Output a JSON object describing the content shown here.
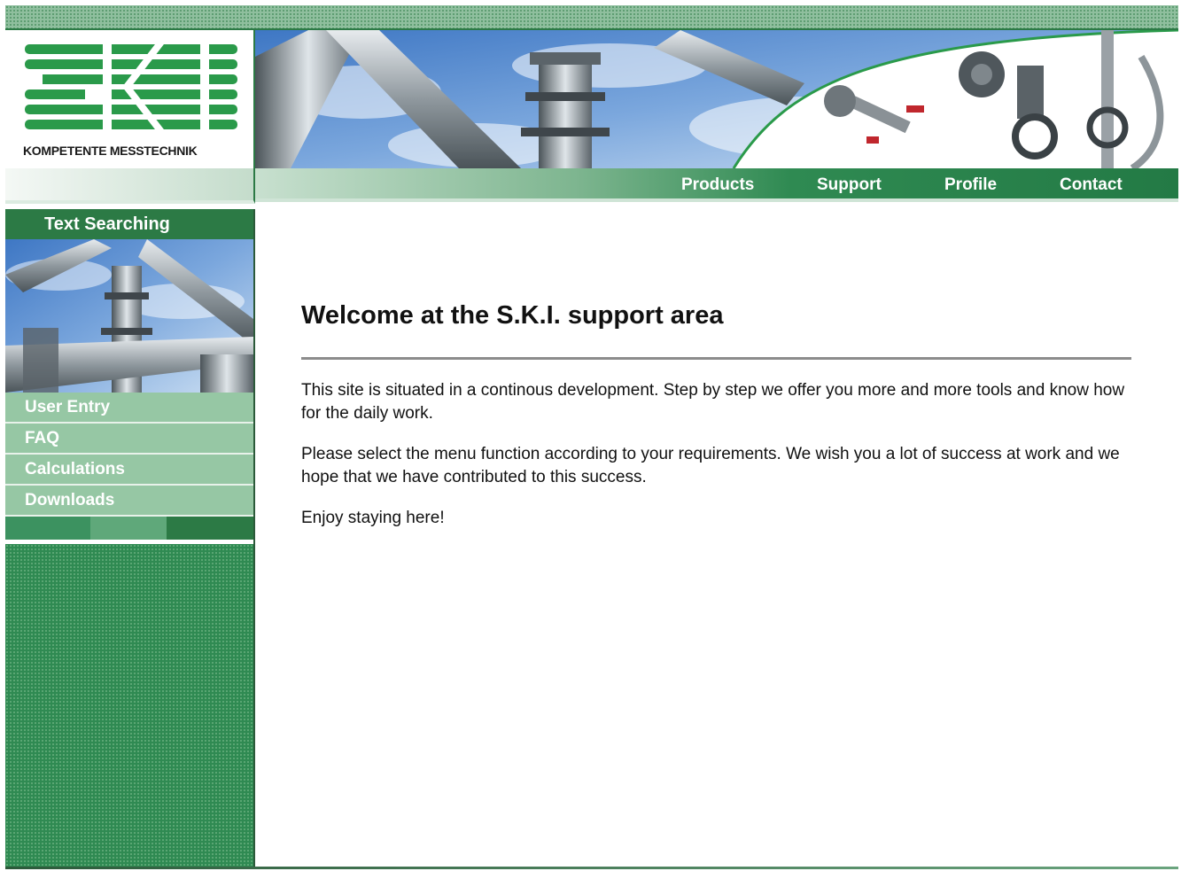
{
  "logo": {
    "tagline": "KOMPETENTE MESSTECHNIK",
    "brand_color": "#2a9a4a"
  },
  "nav": {
    "items": [
      "Products",
      "Support",
      "Profile",
      "Contact"
    ]
  },
  "sidebar": {
    "title": "Text Searching",
    "menu": [
      "User Entry",
      "FAQ",
      "Calculations",
      "Downloads"
    ]
  },
  "main": {
    "heading": "Welcome at the S.K.I. support area",
    "paragraphs": [
      "This site is situated in a continous development. Step by step we offer you more and more tools and know how for the daily work.",
      "Please select the menu function according to your requirements. We wish you a lot of success at work and we hope that we have contributed to this success.",
      "Enjoy staying here!"
    ]
  },
  "colors": {
    "dark_green": "#2c7a45",
    "light_green": "#96c7a4"
  }
}
